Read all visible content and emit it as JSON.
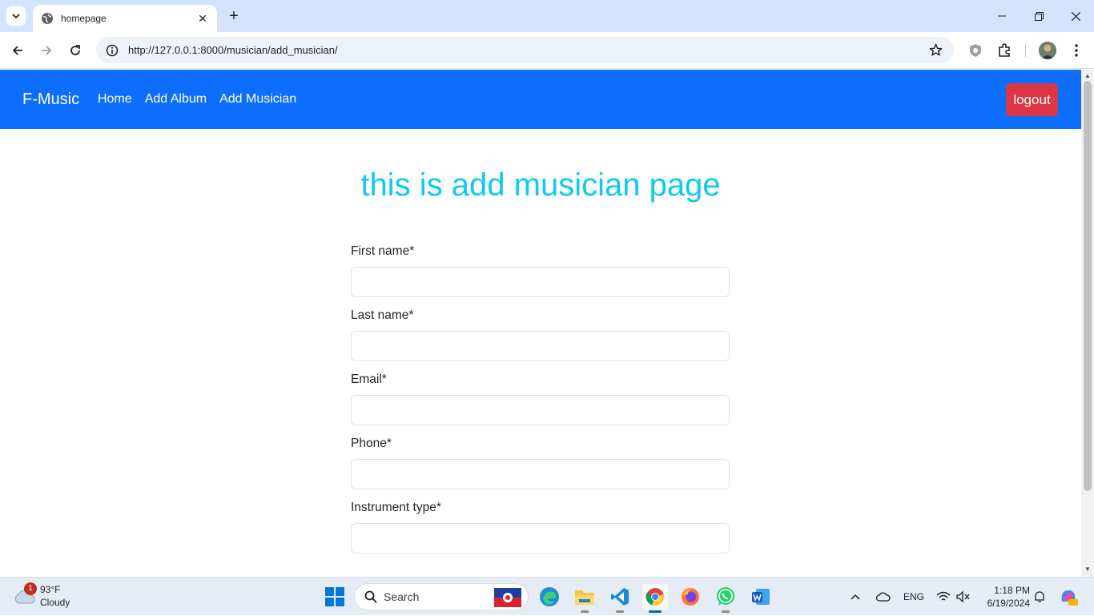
{
  "browser": {
    "tab_title": "homepage",
    "url": "http://127.0.0.1:8000/musician/add_musician/"
  },
  "navbar": {
    "brand": "F-Music",
    "links": [
      "Home",
      "Add Album",
      "Add Musician"
    ],
    "logout_label": "logout",
    "bg_color": "#0d6efd",
    "logout_color": "#dc3545"
  },
  "main": {
    "heading": "this is add musician page",
    "heading_color": "#0dcaf0",
    "fields": [
      {
        "label": "First name*",
        "value": ""
      },
      {
        "label": "Last name*",
        "value": ""
      },
      {
        "label": "Email*",
        "value": ""
      },
      {
        "label": "Phone*",
        "value": ""
      },
      {
        "label": "Instrument type*",
        "value": ""
      }
    ]
  },
  "taskbar": {
    "weather": {
      "temp": "93°F",
      "condition": "Cloudy",
      "badge": "1"
    },
    "search_label": "Search",
    "apps": [
      "edge-icon",
      "file-explorer-icon",
      "vscode-icon",
      "chrome-icon",
      "firefox-icon",
      "whatsapp-icon",
      "word-icon"
    ],
    "tray": {
      "language": "ENG"
    },
    "clock": {
      "time": "1:18 PM",
      "date": "6/19/2024"
    }
  }
}
